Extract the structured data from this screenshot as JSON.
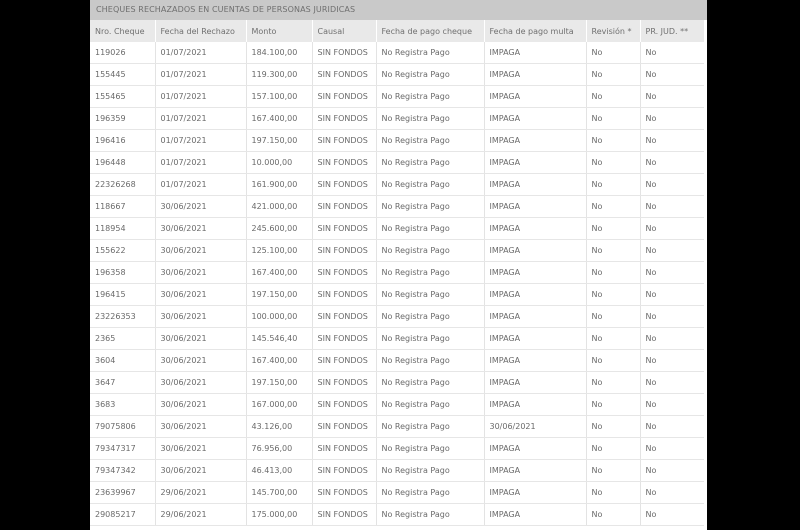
{
  "title": "CHEQUES RECHAZADOS EN CUENTAS DE PERSONAS JURIDICAS",
  "columns": [
    "Nro. Cheque",
    "Fecha del Rechazo",
    "Monto",
    "Causal",
    "Fecha de pago cheque",
    "Fecha de pago multa",
    "Revisión *",
    "PR. JUD. **"
  ],
  "rows": [
    [
      "119026",
      "01/07/2021",
      "184.100,00",
      "SIN FONDOS",
      "No Registra Pago",
      "IMPAGA",
      "No",
      "No"
    ],
    [
      "155445",
      "01/07/2021",
      "119.300,00",
      "SIN FONDOS",
      "No Registra Pago",
      "IMPAGA",
      "No",
      "No"
    ],
    [
      "155465",
      "01/07/2021",
      "157.100,00",
      "SIN FONDOS",
      "No Registra Pago",
      "IMPAGA",
      "No",
      "No"
    ],
    [
      "196359",
      "01/07/2021",
      "167.400,00",
      "SIN FONDOS",
      "No Registra Pago",
      "IMPAGA",
      "No",
      "No"
    ],
    [
      "196416",
      "01/07/2021",
      "197.150,00",
      "SIN FONDOS",
      "No Registra Pago",
      "IMPAGA",
      "No",
      "No"
    ],
    [
      "196448",
      "01/07/2021",
      "10.000,00",
      "SIN FONDOS",
      "No Registra Pago",
      "IMPAGA",
      "No",
      "No"
    ],
    [
      "22326268",
      "01/07/2021",
      "161.900,00",
      "SIN FONDOS",
      "No Registra Pago",
      "IMPAGA",
      "No",
      "No"
    ],
    [
      "118667",
      "30/06/2021",
      "421.000,00",
      "SIN FONDOS",
      "No Registra Pago",
      "IMPAGA",
      "No",
      "No"
    ],
    [
      "118954",
      "30/06/2021",
      "245.600,00",
      "SIN FONDOS",
      "No Registra Pago",
      "IMPAGA",
      "No",
      "No"
    ],
    [
      "155622",
      "30/06/2021",
      "125.100,00",
      "SIN FONDOS",
      "No Registra Pago",
      "IMPAGA",
      "No",
      "No"
    ],
    [
      "196358",
      "30/06/2021",
      "167.400,00",
      "SIN FONDOS",
      "No Registra Pago",
      "IMPAGA",
      "No",
      "No"
    ],
    [
      "196415",
      "30/06/2021",
      "197.150,00",
      "SIN FONDOS",
      "No Registra Pago",
      "IMPAGA",
      "No",
      "No"
    ],
    [
      "23226353",
      "30/06/2021",
      "100.000,00",
      "SIN FONDOS",
      "No Registra Pago",
      "IMPAGA",
      "No",
      "No"
    ],
    [
      "2365",
      "30/06/2021",
      "145.546,40",
      "SIN FONDOS",
      "No Registra Pago",
      "IMPAGA",
      "No",
      "No"
    ],
    [
      "3604",
      "30/06/2021",
      "167.400,00",
      "SIN FONDOS",
      "No Registra Pago",
      "IMPAGA",
      "No",
      "No"
    ],
    [
      "3647",
      "30/06/2021",
      "197.150,00",
      "SIN FONDOS",
      "No Registra Pago",
      "IMPAGA",
      "No",
      "No"
    ],
    [
      "3683",
      "30/06/2021",
      "167.000,00",
      "SIN FONDOS",
      "No Registra Pago",
      "IMPAGA",
      "No",
      "No"
    ],
    [
      "79075806",
      "30/06/2021",
      "43.126,00",
      "SIN FONDOS",
      "No Registra Pago",
      "30/06/2021",
      "No",
      "No"
    ],
    [
      "79347317",
      "30/06/2021",
      "76.956,00",
      "SIN FONDOS",
      "No Registra Pago",
      "IMPAGA",
      "No",
      "No"
    ],
    [
      "79347342",
      "30/06/2021",
      "46.413,00",
      "SIN FONDOS",
      "No Registra Pago",
      "IMPAGA",
      "No",
      "No"
    ],
    [
      "23639967",
      "29/06/2021",
      "145.700,00",
      "SIN FONDOS",
      "No Registra Pago",
      "IMPAGA",
      "No",
      "No"
    ],
    [
      "29085217",
      "29/06/2021",
      "175.000,00",
      "SIN FONDOS",
      "No Registra Pago",
      "IMPAGA",
      "No",
      "No"
    ]
  ]
}
